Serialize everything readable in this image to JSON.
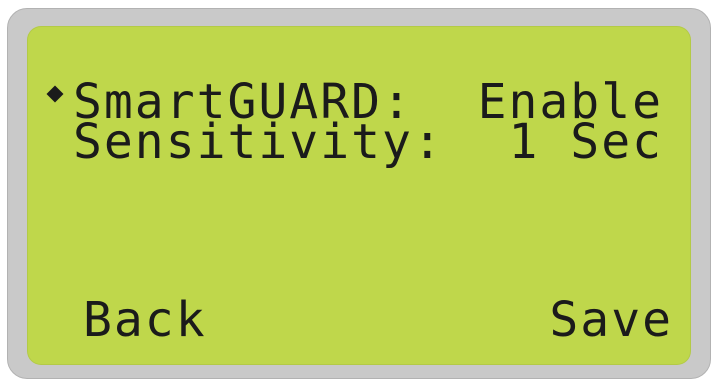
{
  "lcd": {
    "menu_items": [
      {
        "label": "SmartGUARD:",
        "value": "Enable",
        "selected": true
      },
      {
        "label": "Sensitivity:",
        "value": "1 Sec",
        "selected": false
      }
    ],
    "softkeys": {
      "left": "Back",
      "right": "Save"
    },
    "colors": {
      "bezel": "#c9c9c9",
      "screen": "#bfd74b",
      "text": "#1b1b1b"
    },
    "cursor_icon": "diamond-cursor-icon"
  }
}
